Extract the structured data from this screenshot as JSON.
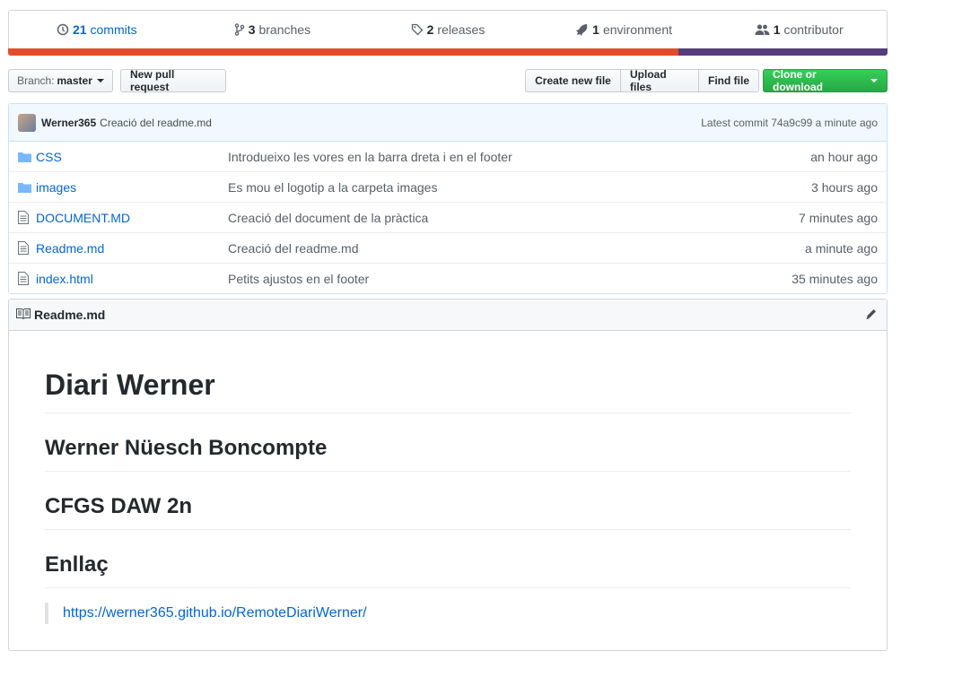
{
  "summary": {
    "commits": {
      "count": "21",
      "label": "commits"
    },
    "branches": {
      "count": "3",
      "label": "branches"
    },
    "releases": {
      "count": "2",
      "label": "releases"
    },
    "environment": {
      "count": "1",
      "label": "environment"
    },
    "contributor": {
      "count": "1",
      "label": "contributor"
    }
  },
  "language_bar": [
    {
      "color": "#e34c26",
      "fraction": 0.762
    },
    {
      "color": "#563d7c",
      "fraction": 0.238
    }
  ],
  "toolbar": {
    "branch_prefix": "Branch:",
    "branch_name": "master",
    "new_pull_request": "New pull request",
    "create_new_file": "Create new file",
    "upload_files": "Upload files",
    "find_file": "Find file",
    "clone_or_download": "Clone or download"
  },
  "latest_commit": {
    "author": "Werner365",
    "message": "Creació del readme.md",
    "label": "Latest commit 74a9c99 a minute ago"
  },
  "files": [
    {
      "type": "folder",
      "name": "CSS",
      "message": "Introdueixo les vores en la barra dreta i en el footer",
      "age": "an hour ago"
    },
    {
      "type": "folder",
      "name": "images",
      "message": "Es mou el logotip a la carpeta images",
      "age": "3 hours ago"
    },
    {
      "type": "file",
      "name": "DOCUMENT.MD",
      "message": "Creació del document de la pràctica",
      "age": "7 minutes ago"
    },
    {
      "type": "file",
      "name": "Readme.md",
      "message": "Creació del readme.md",
      "age": "a minute ago"
    },
    {
      "type": "file",
      "name": "index.html",
      "message": "Petits ajustos en el footer",
      "age": "35 minutes ago"
    }
  ],
  "readme": {
    "filename": "Readme.md",
    "h1": "Diari Werner",
    "h2_author": "Werner Nüesch Boncompte",
    "h2_course": "CFGS DAW 2n",
    "h2_link": "Enllaç",
    "link": "https://werner365.github.io/RemoteDiariWerner/"
  }
}
